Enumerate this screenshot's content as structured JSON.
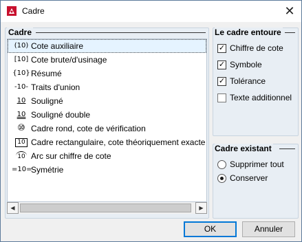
{
  "window": {
    "title": "Cadre",
    "close_icon": "✕"
  },
  "left_group": {
    "title": "Cadre",
    "items": [
      {
        "icon": "(10)",
        "label": "Cote auxiliaire",
        "selected": true
      },
      {
        "icon": "[10]",
        "label": "Cote brute/d'usinage"
      },
      {
        "icon": "{10}",
        "label": "Résumé"
      },
      {
        "icon": "-10-",
        "label": "Traits d'union"
      },
      {
        "icon": "10",
        "label": "Souligné"
      },
      {
        "icon": "10",
        "label": "Souligné double"
      },
      {
        "icon": "⑩",
        "label": "Cadre rond, cote de vérification"
      },
      {
        "icon": "10",
        "label": "Cadre rectangulaire, cote théoriquement exacte"
      },
      {
        "icon": "10",
        "label": "Arc sur chiffre de cote"
      },
      {
        "icon": "=10=",
        "label": "Symétrie"
      }
    ]
  },
  "right_group_1": {
    "title": "Le cadre entoure",
    "options": [
      {
        "label": "Chiffre de cote",
        "checked": true
      },
      {
        "label": "Symbole",
        "checked": true
      },
      {
        "label": "Tolérance",
        "checked": true
      },
      {
        "label": "Texte additionnel",
        "checked": false
      }
    ]
  },
  "right_group_2": {
    "title": "Cadre existant",
    "options": [
      {
        "label": "Supprimer tout",
        "selected": false
      },
      {
        "label": "Conserver",
        "selected": true
      }
    ]
  },
  "buttons": {
    "ok": "OK",
    "cancel": "Annuler"
  },
  "scroll": {
    "left_arrow": "◀",
    "right_arrow": "▶"
  }
}
